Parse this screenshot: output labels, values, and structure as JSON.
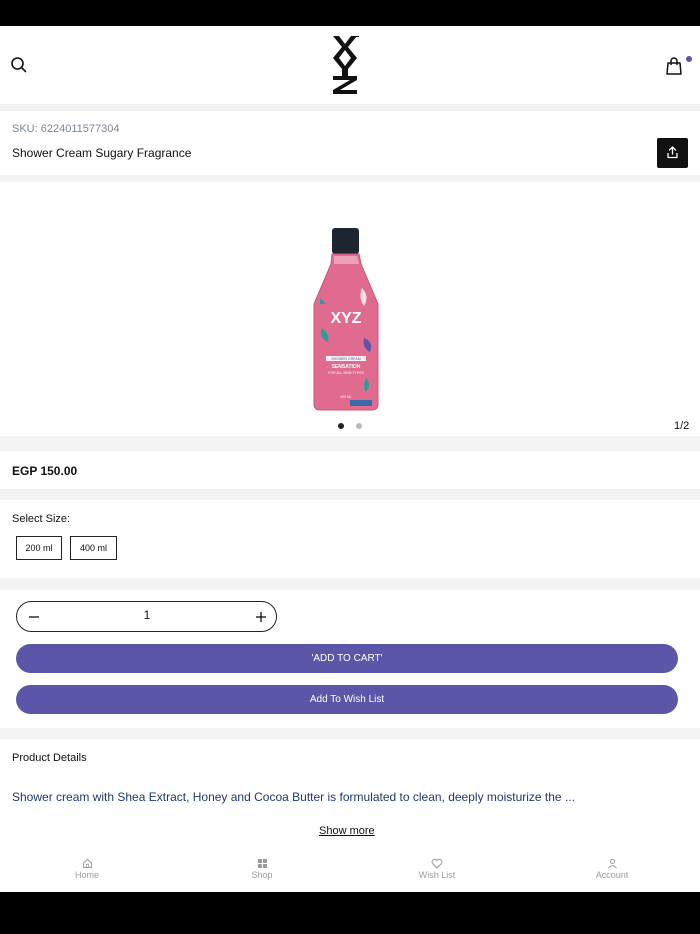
{
  "header": {
    "logo_text": "XYZ",
    "logo_subtext": "XYZ"
  },
  "product": {
    "sku": "SKU: 6224011577304",
    "title": "Shower Cream Sugary Fragrance",
    "pager": "1/2",
    "price": "EGP 150.00",
    "bottle_label": {
      "brand": "XYZ",
      "type": "SHOWER CREAM",
      "name": "SENSATION",
      "sub": "FOR ALL SKIN TYPES",
      "volume": "400 ML"
    },
    "colors": {
      "bottle": "#e06b8e",
      "cap": "#1c2530",
      "accent": "#5b56a8"
    }
  },
  "size": {
    "label": "Select Size:",
    "options": [
      "200 ml",
      "400 ml"
    ]
  },
  "quantity": {
    "value": "1"
  },
  "buttons": {
    "add_to_cart": "'ADD TO CART'",
    "add_to_wishlist": "Add To Wish List"
  },
  "details": {
    "title": "Product Details",
    "text": "Shower cream with Shea Extract, Honey and Cocoa Butter is formulated to clean, deeply moisturize the ...",
    "show_more": "Show more"
  },
  "nav": {
    "items": [
      {
        "label": "Home",
        "icon": "home-icon"
      },
      {
        "label": "Shop",
        "icon": "grid-icon"
      },
      {
        "label": "Wish List",
        "icon": "heart-icon"
      },
      {
        "label": "Account",
        "icon": "user-icon"
      }
    ]
  }
}
